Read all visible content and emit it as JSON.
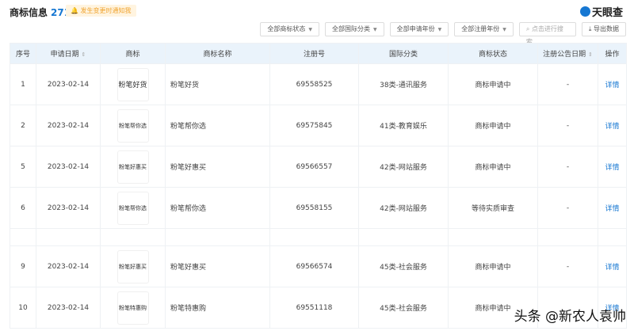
{
  "header": {
    "title": "商标信息",
    "count": "271",
    "notice": "发生变更时通知我",
    "logo": "天眼查"
  },
  "filters": {
    "status": "全部商标状态",
    "intl": "全部国际分类",
    "apply_year": "全部申请年份",
    "reg_year": "全部注册年份",
    "search_placeholder": "点击进行搜索",
    "export": "导出数据"
  },
  "columns": [
    "序号",
    "申请日期",
    "商标",
    "商标名称",
    "注册号",
    "国际分类",
    "商标状态",
    "注册公告日期",
    "操作"
  ],
  "sort_icon": "⇕",
  "rows": [
    {
      "no": "1",
      "date": "2023-02-14",
      "logo": "粉笔好货",
      "name": "粉笔好货",
      "reg": "69558525",
      "cls": "38类-通讯服务",
      "status": "商标申请中",
      "pub": "-",
      "action": "详情"
    },
    {
      "no": "2",
      "date": "2023-02-14",
      "logo": "粉笔帮你选",
      "name": "粉笔帮你选",
      "reg": "69575845",
      "cls": "41类-教育娱乐",
      "status": "商标申请中",
      "pub": "-",
      "action": "详情"
    },
    {
      "no": "5",
      "date": "2023-02-14",
      "logo": "粉笔好惠买",
      "name": "粉笔好惠买",
      "reg": "69566557",
      "cls": "42类-网站服务",
      "status": "商标申请中",
      "pub": "-",
      "action": "详情"
    },
    {
      "no": "6",
      "date": "2023-02-14",
      "logo": "粉笔帮你选",
      "name": "粉笔帮你选",
      "reg": "69558155",
      "cls": "42类-网站服务",
      "status": "等待实质审查",
      "pub": "-",
      "action": "详情"
    },
    {
      "no": "9",
      "date": "2023-02-14",
      "logo": "粉笔好惠买",
      "name": "粉笔好惠买",
      "reg": "69566574",
      "cls": "45类-社会服务",
      "status": "商标申请中",
      "pub": "-",
      "action": "详情"
    },
    {
      "no": "10",
      "date": "2023-02-14",
      "logo": "粉笔特惠购",
      "name": "粉笔特惠购",
      "reg": "69551118",
      "cls": "45类-社会服务",
      "status": "商标申请中",
      "pub": "",
      "action": "详情"
    }
  ],
  "watermark": "头条 @新农人袁帅"
}
